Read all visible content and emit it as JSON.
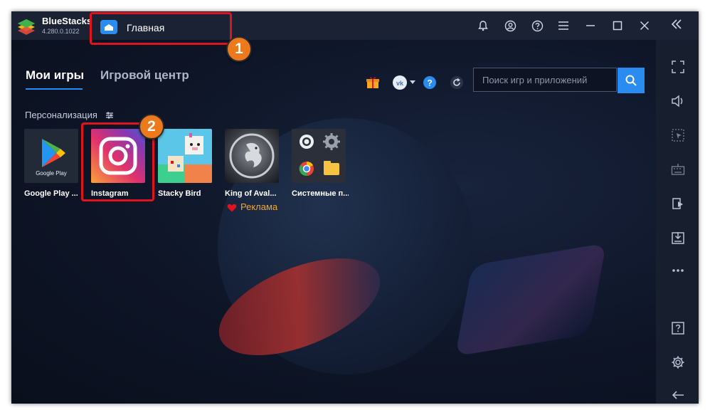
{
  "titlebar": {
    "brand": "BlueStacks",
    "version": "4.280.0.1022",
    "home_tab_label": "Главная"
  },
  "nav": {
    "my_games": "Мои игры",
    "game_center": "Игровой центр"
  },
  "search": {
    "placeholder": "Поиск игр и приложений"
  },
  "section": {
    "title": "Персонализация"
  },
  "apps": [
    {
      "label": "Google Play ...",
      "icon": "google-play-icon",
      "tile_text": "Google Play"
    },
    {
      "label": "Instagram",
      "icon": "instagram-icon"
    },
    {
      "label": "Stacky Bird",
      "icon": "stacky-bird-icon"
    },
    {
      "label": "King of Aval...",
      "icon": "king-of-avalon-icon"
    },
    {
      "label": "Системные п...",
      "icon": "system-apps-icon"
    }
  ],
  "ad": {
    "label": "Реклама"
  },
  "annotations": {
    "step1": "1",
    "step2": "2"
  },
  "colors": {
    "accent": "#2a8cf0",
    "highlight": "#e0141e",
    "badge": "#ec7a1c",
    "ad": "#f5a623"
  }
}
